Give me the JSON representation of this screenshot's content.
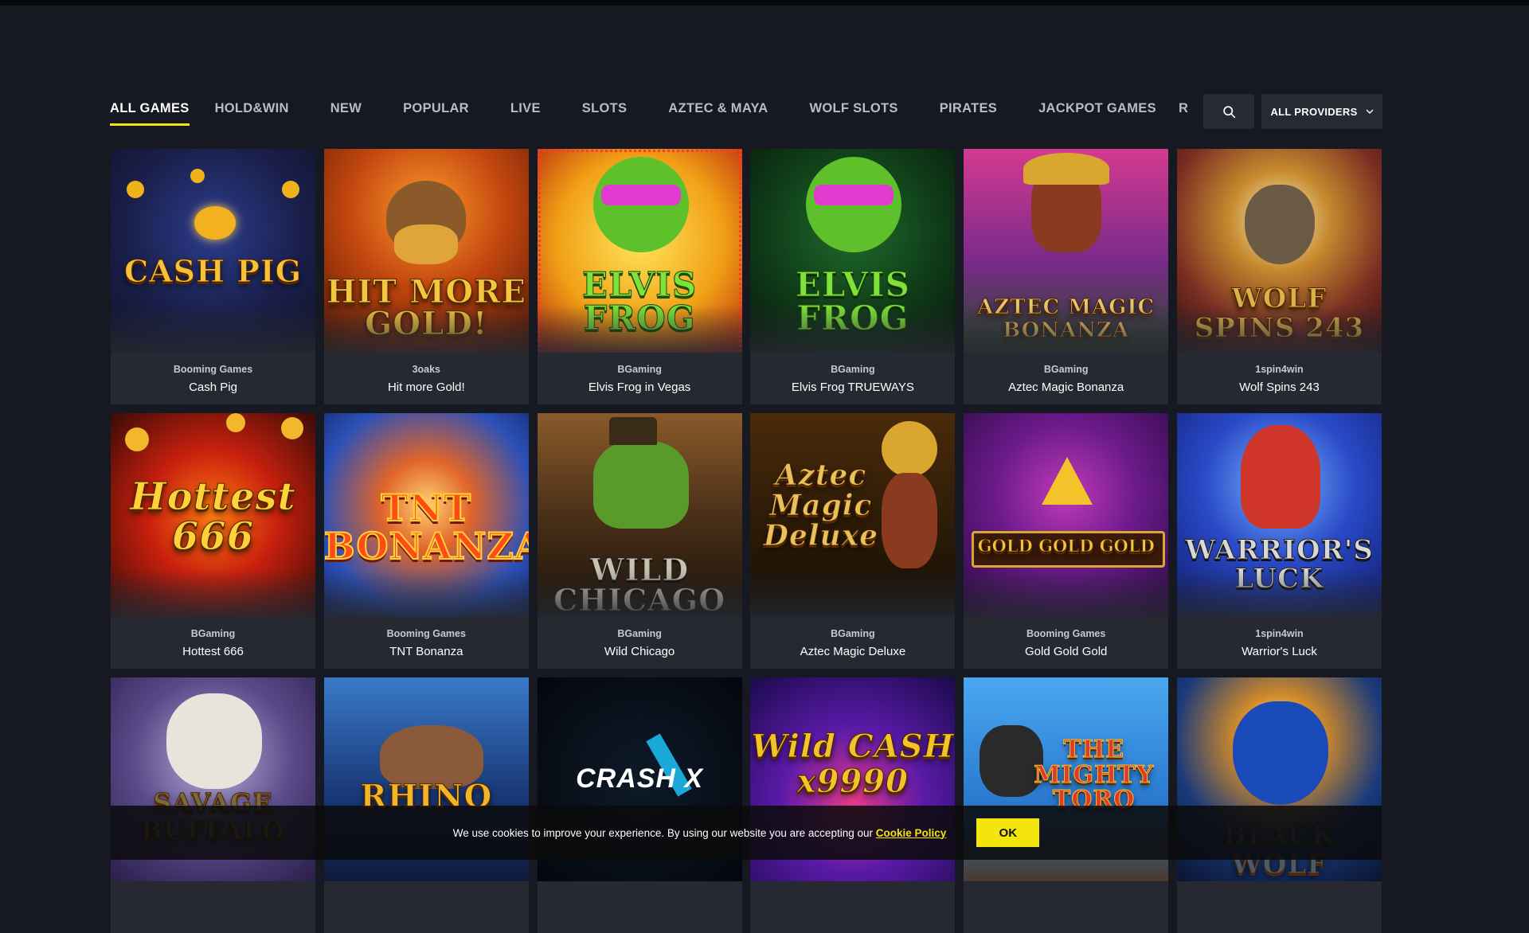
{
  "tabs": [
    {
      "label": "ALL GAMES",
      "active": true
    },
    {
      "label": "HOLD&WIN"
    },
    {
      "label": "NEW"
    },
    {
      "label": "POPULAR"
    },
    {
      "label": "LIVE"
    },
    {
      "label": "SLOTS"
    },
    {
      "label": "AZTEC & MAYA"
    },
    {
      "label": "WOLF SLOTS"
    },
    {
      "label": "PIRATES"
    },
    {
      "label": "JACKPOT GAMES"
    }
  ],
  "tab_overflow": "R",
  "search": {
    "icon": "search-icon"
  },
  "providers_filter": {
    "label": "ALL PROVIDERS",
    "icon": "chevron-down-icon"
  },
  "games": [
    {
      "provider": "Booming Games",
      "title": "Cash Pig",
      "logo": "CASH PIG"
    },
    {
      "provider": "3oaks",
      "title": "Hit more Gold!",
      "logo": "HIT MORE GOLD!"
    },
    {
      "provider": "BGaming",
      "title": "Elvis Frog in Vegas",
      "logo": "ELVIS FROG"
    },
    {
      "provider": "BGaming",
      "title": "Elvis Frog TRUEWAYS",
      "logo": "ELVIS FROG"
    },
    {
      "provider": "BGaming",
      "title": "Aztec Magic Bonanza",
      "logo": "AZTEC MAGIC BONANZA"
    },
    {
      "provider": "1spin4win",
      "title": "Wolf Spins 243",
      "logo": "WOLF SPINS 243"
    },
    {
      "provider": "BGaming",
      "title": "Hottest 666",
      "logo": "Hottest 666"
    },
    {
      "provider": "Booming Games",
      "title": "TNT Bonanza",
      "logo": "TNT BONANZA"
    },
    {
      "provider": "BGaming",
      "title": "Wild Chicago",
      "logo": "WILD CHICAGO"
    },
    {
      "provider": "BGaming",
      "title": "Aztec Magic Deluxe",
      "logo": "Aztec Magic Deluxe"
    },
    {
      "provider": "Booming Games",
      "title": "Gold Gold Gold",
      "logo": "GOLD GOLD GOLD"
    },
    {
      "provider": "1spin4win",
      "title": "Warrior's Luck",
      "logo": "WARRIOR'S LUCK"
    },
    {
      "provider": "",
      "title": "",
      "logo": "SAVAGE BUFFALO"
    },
    {
      "provider": "",
      "title": "",
      "logo": "RHINO"
    },
    {
      "provider": "",
      "title": "",
      "logo": "CRASH X"
    },
    {
      "provider": "",
      "title": "",
      "logo": "Wild CASH x9990"
    },
    {
      "provider": "",
      "title": "",
      "logo": "THE MIGHTY TORO"
    },
    {
      "provider": "",
      "title": "",
      "logo": "BLACK WOLF"
    }
  ],
  "cookie": {
    "text": "We use cookies to improve your experience. By using our website you are accepting our",
    "link": "Cookie Policy",
    "button": "OK"
  },
  "colors": {
    "accent": "#f4e50c",
    "background": "#161922",
    "card": "#262931"
  }
}
